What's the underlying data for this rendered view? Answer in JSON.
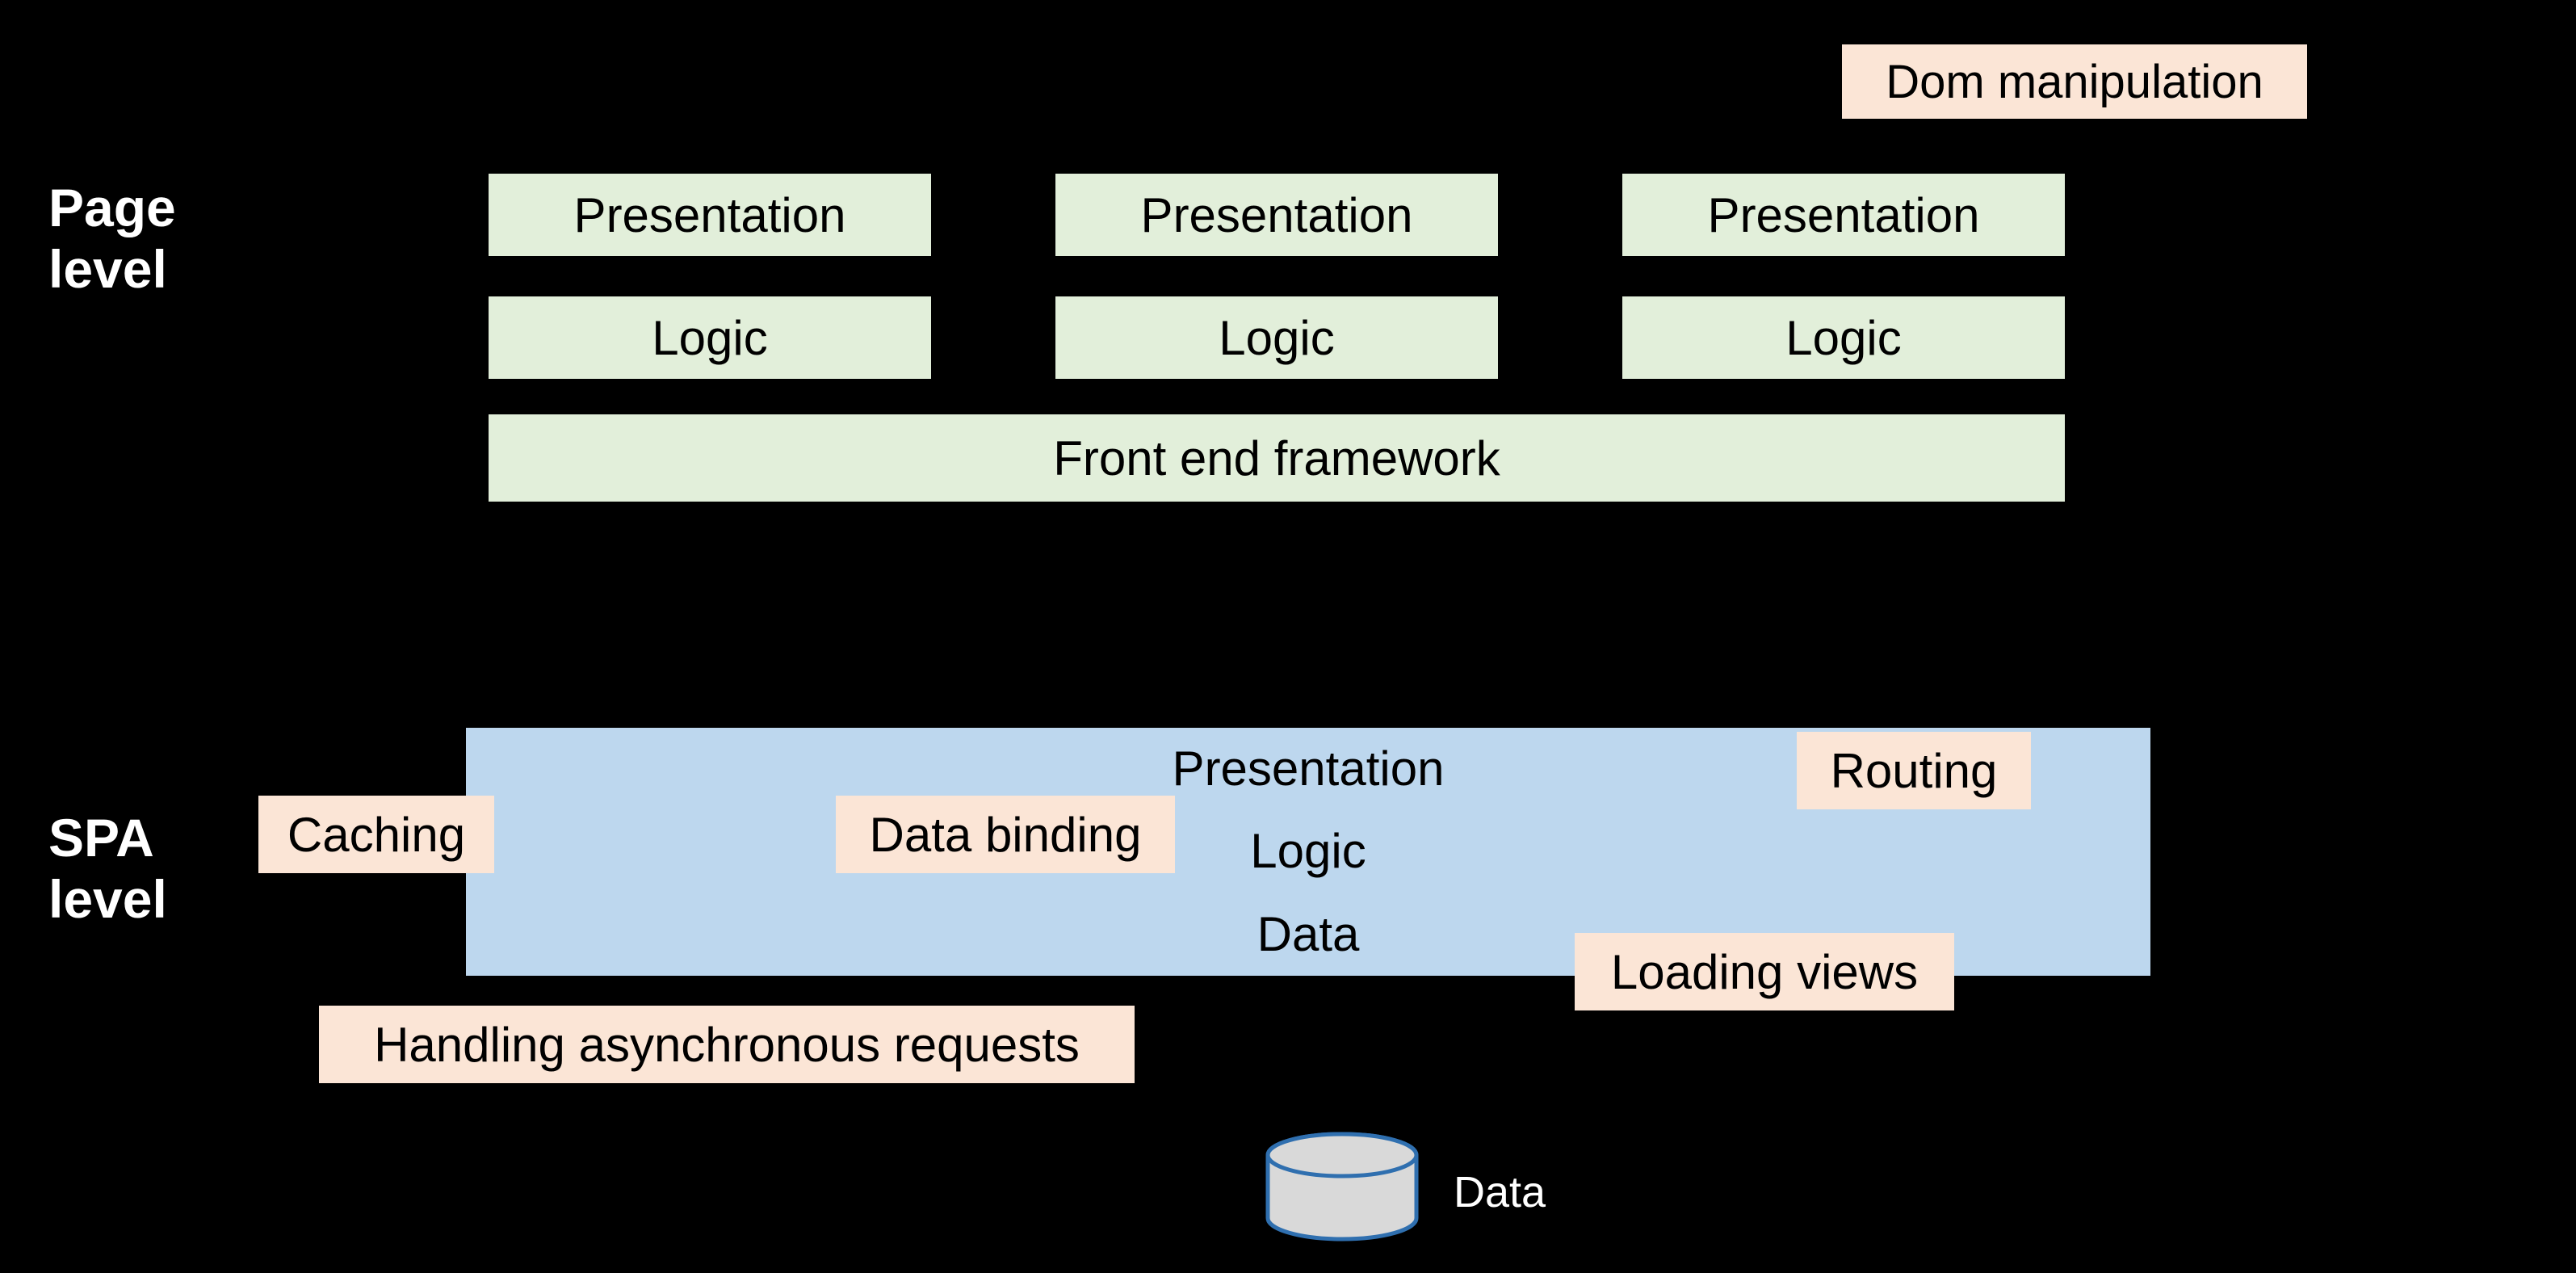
{
  "labels": {
    "page": {
      "line1": "Page",
      "line2": "level"
    },
    "spa": {
      "line1": "SPA",
      "line2": "level"
    }
  },
  "top": {
    "col1": {
      "presentation": "Presentation",
      "logic": "Logic"
    },
    "col2": {
      "presentation": "Presentation",
      "logic": "Logic"
    },
    "col3": {
      "presentation": "Presentation",
      "logic": "Logic"
    },
    "framework": "Front end framework",
    "tag_dom": "Dom manipulation"
  },
  "bottom": {
    "row_presentation": "Presentation",
    "row_logic": "Logic",
    "row_data": "Data",
    "tag_caching": "Caching",
    "tag_databinding": "Data binding",
    "tag_routing": "Routing",
    "tag_loading": "Loading views",
    "tag_async": "Handling asynchronous requests"
  },
  "footer": {
    "data_label": "Data"
  }
}
